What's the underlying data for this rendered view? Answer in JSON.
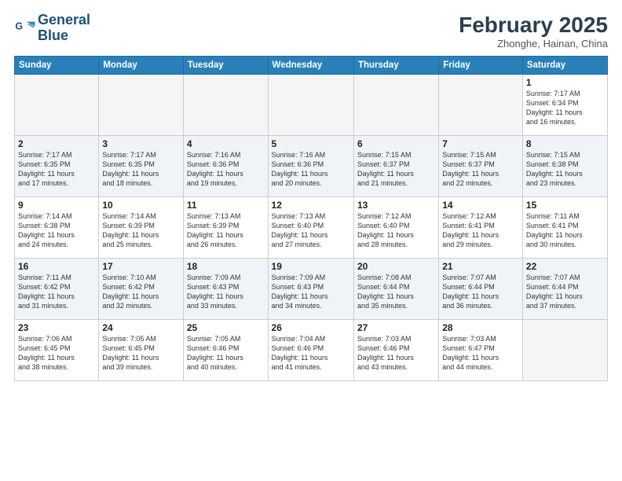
{
  "header": {
    "logo_line1": "General",
    "logo_line2": "Blue",
    "month": "February 2025",
    "location": "Zhonghe, Hainan, China"
  },
  "weekdays": [
    "Sunday",
    "Monday",
    "Tuesday",
    "Wednesday",
    "Thursday",
    "Friday",
    "Saturday"
  ],
  "weeks": [
    [
      {
        "day": "",
        "info": ""
      },
      {
        "day": "",
        "info": ""
      },
      {
        "day": "",
        "info": ""
      },
      {
        "day": "",
        "info": ""
      },
      {
        "day": "",
        "info": ""
      },
      {
        "day": "",
        "info": ""
      },
      {
        "day": "1",
        "info": "Sunrise: 7:17 AM\nSunset: 6:34 PM\nDaylight: 11 hours\nand 16 minutes."
      }
    ],
    [
      {
        "day": "2",
        "info": "Sunrise: 7:17 AM\nSunset: 6:35 PM\nDaylight: 11 hours\nand 17 minutes."
      },
      {
        "day": "3",
        "info": "Sunrise: 7:17 AM\nSunset: 6:35 PM\nDaylight: 11 hours\nand 18 minutes."
      },
      {
        "day": "4",
        "info": "Sunrise: 7:16 AM\nSunset: 6:36 PM\nDaylight: 11 hours\nand 19 minutes."
      },
      {
        "day": "5",
        "info": "Sunrise: 7:16 AM\nSunset: 6:36 PM\nDaylight: 11 hours\nand 20 minutes."
      },
      {
        "day": "6",
        "info": "Sunrise: 7:15 AM\nSunset: 6:37 PM\nDaylight: 11 hours\nand 21 minutes."
      },
      {
        "day": "7",
        "info": "Sunrise: 7:15 AM\nSunset: 6:37 PM\nDaylight: 11 hours\nand 22 minutes."
      },
      {
        "day": "8",
        "info": "Sunrise: 7:15 AM\nSunset: 6:38 PM\nDaylight: 11 hours\nand 23 minutes."
      }
    ],
    [
      {
        "day": "9",
        "info": "Sunrise: 7:14 AM\nSunset: 6:38 PM\nDaylight: 11 hours\nand 24 minutes."
      },
      {
        "day": "10",
        "info": "Sunrise: 7:14 AM\nSunset: 6:39 PM\nDaylight: 11 hours\nand 25 minutes."
      },
      {
        "day": "11",
        "info": "Sunrise: 7:13 AM\nSunset: 6:39 PM\nDaylight: 11 hours\nand 26 minutes."
      },
      {
        "day": "12",
        "info": "Sunrise: 7:13 AM\nSunset: 6:40 PM\nDaylight: 11 hours\nand 27 minutes."
      },
      {
        "day": "13",
        "info": "Sunrise: 7:12 AM\nSunset: 6:40 PM\nDaylight: 11 hours\nand 28 minutes."
      },
      {
        "day": "14",
        "info": "Sunrise: 7:12 AM\nSunset: 6:41 PM\nDaylight: 11 hours\nand 29 minutes."
      },
      {
        "day": "15",
        "info": "Sunrise: 7:11 AM\nSunset: 6:41 PM\nDaylight: 11 hours\nand 30 minutes."
      }
    ],
    [
      {
        "day": "16",
        "info": "Sunrise: 7:11 AM\nSunset: 6:42 PM\nDaylight: 11 hours\nand 31 minutes."
      },
      {
        "day": "17",
        "info": "Sunrise: 7:10 AM\nSunset: 6:42 PM\nDaylight: 11 hours\nand 32 minutes."
      },
      {
        "day": "18",
        "info": "Sunrise: 7:09 AM\nSunset: 6:43 PM\nDaylight: 11 hours\nand 33 minutes."
      },
      {
        "day": "19",
        "info": "Sunrise: 7:09 AM\nSunset: 6:43 PM\nDaylight: 11 hours\nand 34 minutes."
      },
      {
        "day": "20",
        "info": "Sunrise: 7:08 AM\nSunset: 6:44 PM\nDaylight: 11 hours\nand 35 minutes."
      },
      {
        "day": "21",
        "info": "Sunrise: 7:07 AM\nSunset: 6:44 PM\nDaylight: 11 hours\nand 36 minutes."
      },
      {
        "day": "22",
        "info": "Sunrise: 7:07 AM\nSunset: 6:44 PM\nDaylight: 11 hours\nand 37 minutes."
      }
    ],
    [
      {
        "day": "23",
        "info": "Sunrise: 7:06 AM\nSunset: 6:45 PM\nDaylight: 11 hours\nand 38 minutes."
      },
      {
        "day": "24",
        "info": "Sunrise: 7:05 AM\nSunset: 6:45 PM\nDaylight: 11 hours\nand 39 minutes."
      },
      {
        "day": "25",
        "info": "Sunrise: 7:05 AM\nSunset: 6:46 PM\nDaylight: 11 hours\nand 40 minutes."
      },
      {
        "day": "26",
        "info": "Sunrise: 7:04 AM\nSunset: 6:46 PM\nDaylight: 11 hours\nand 41 minutes."
      },
      {
        "day": "27",
        "info": "Sunrise: 7:03 AM\nSunset: 6:46 PM\nDaylight: 11 hours\nand 43 minutes."
      },
      {
        "day": "28",
        "info": "Sunrise: 7:03 AM\nSunset: 6:47 PM\nDaylight: 11 hours\nand 44 minutes."
      },
      {
        "day": "",
        "info": ""
      }
    ]
  ]
}
